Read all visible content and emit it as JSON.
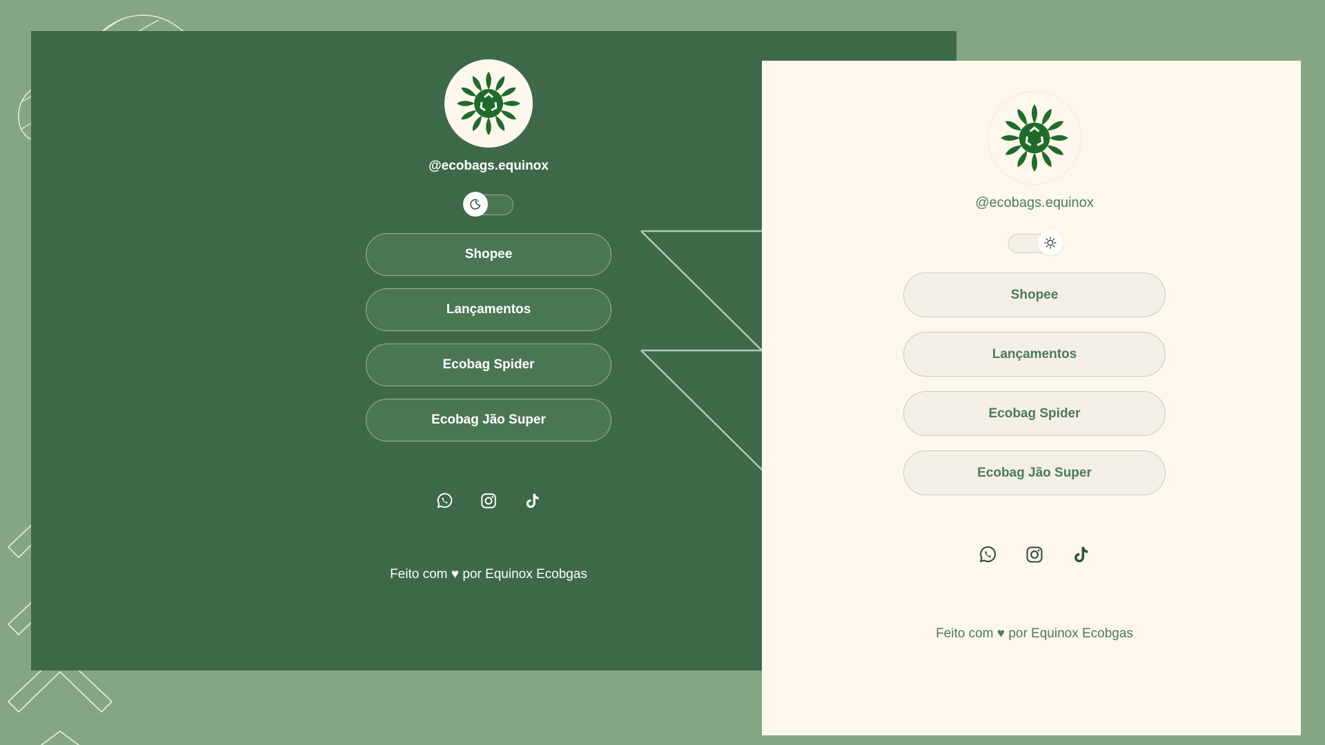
{
  "colors": {
    "background": "#84a684",
    "dark_panel": "#3e6948",
    "light_panel": "#fdf7ec",
    "accent_green": "#1f6b2b",
    "light_text": "#4d7a59"
  },
  "dark_theme": {
    "username": "@ecobags.equinox",
    "theme_toggle": {
      "state": "dark",
      "knob_icon": "moon-icon"
    },
    "links": [
      {
        "label": "Shopee"
      },
      {
        "label": "Lançamentos"
      },
      {
        "label": "Ecobag Spider"
      },
      {
        "label": "Ecobag Jão Super"
      }
    ],
    "socials": [
      "whatsapp-icon",
      "instagram-icon",
      "tiktok-icon"
    ],
    "footer": "Feito com ♥ por Equinox Ecobgas"
  },
  "light_theme": {
    "username": "@ecobags.equinox",
    "theme_toggle": {
      "state": "light",
      "knob_icon": "sun-icon"
    },
    "links": [
      {
        "label": "Shopee"
      },
      {
        "label": "Lançamentos"
      },
      {
        "label": "Ecobag Spider"
      },
      {
        "label": "Ecobag Jão Super"
      }
    ],
    "socials": [
      "whatsapp-icon",
      "instagram-icon",
      "tiktok-icon"
    ],
    "footer": "Feito com ♥ por Equinox Ecobgas"
  }
}
